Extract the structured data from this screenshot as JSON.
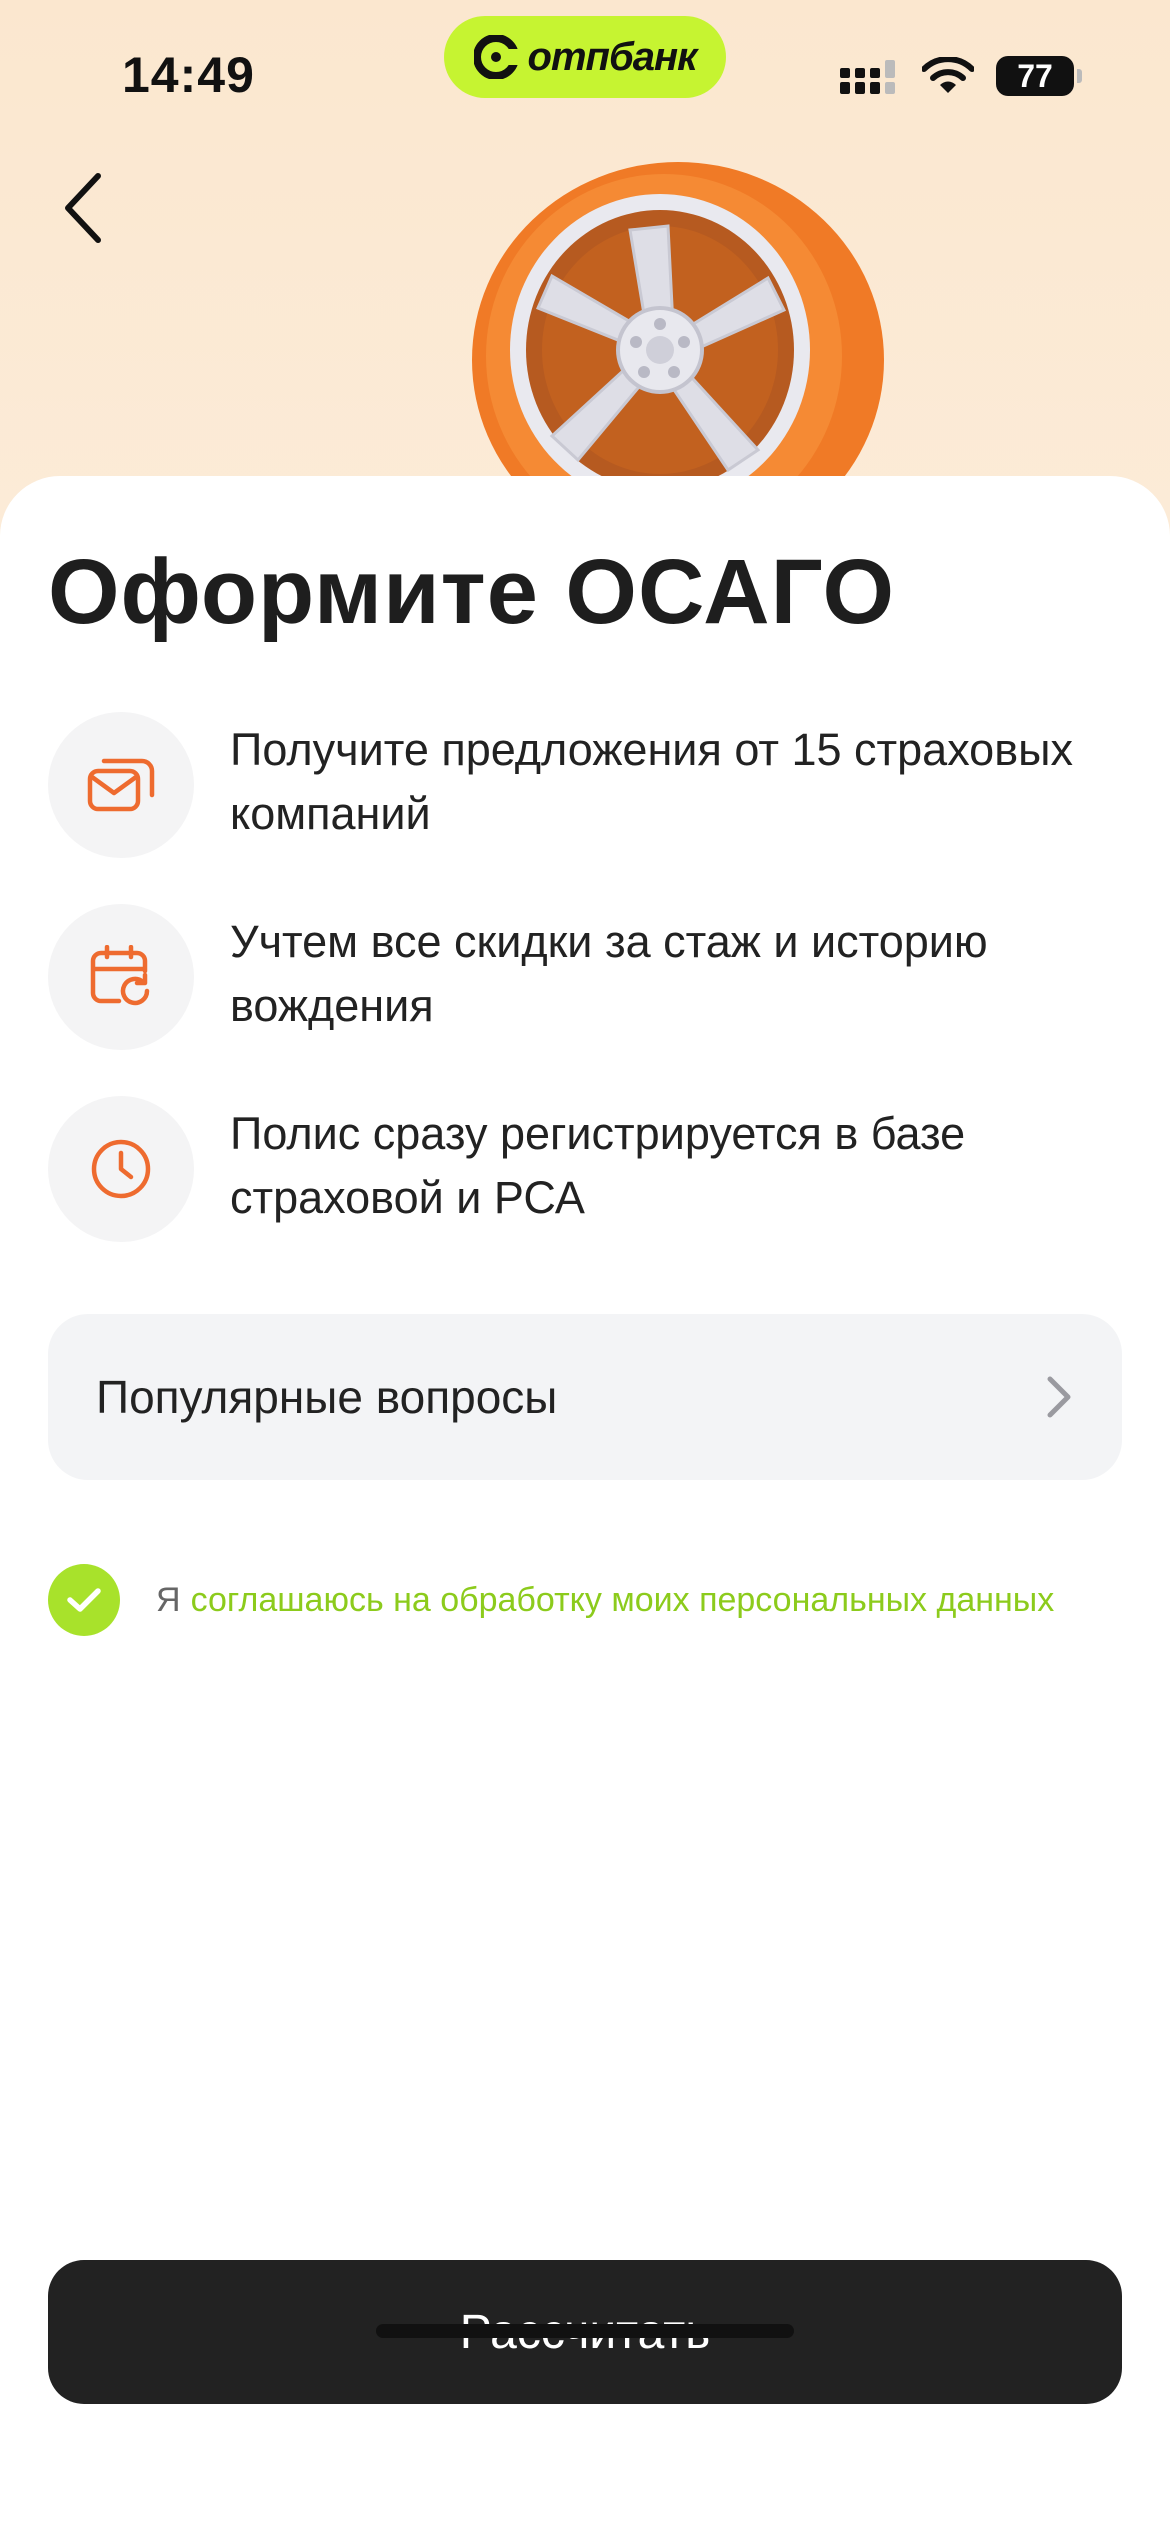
{
  "status_bar": {
    "time": "14:49",
    "battery": "77"
  },
  "bank": {
    "name": "отпбанк",
    "accent": "#c6f431"
  },
  "header": {
    "back_icon": "chevron-left-icon"
  },
  "main": {
    "title": "Оформите ОСАГО",
    "features": [
      {
        "icon": "envelopes-icon",
        "text": "Получите предложения от 15 страховых компаний"
      },
      {
        "icon": "calendar-refresh-icon",
        "text": "Учтем все скидки за стаж и историю вождения"
      },
      {
        "icon": "clock-icon",
        "text": "Полис сразу регистрируется в базе страховой и РСА"
      }
    ],
    "faq": {
      "label": "Популярные вопросы",
      "icon": "chevron-right-icon"
    },
    "consent": {
      "checked": true,
      "prefix": "Я",
      "link_text": "соглашаюсь на обработку моих персональных данных"
    },
    "cta": {
      "label": "Рассчитать"
    }
  },
  "colors": {
    "icon_orange": "#ee6b2f",
    "consent_green": "#a8e22b",
    "cta_dark": "#222222"
  }
}
